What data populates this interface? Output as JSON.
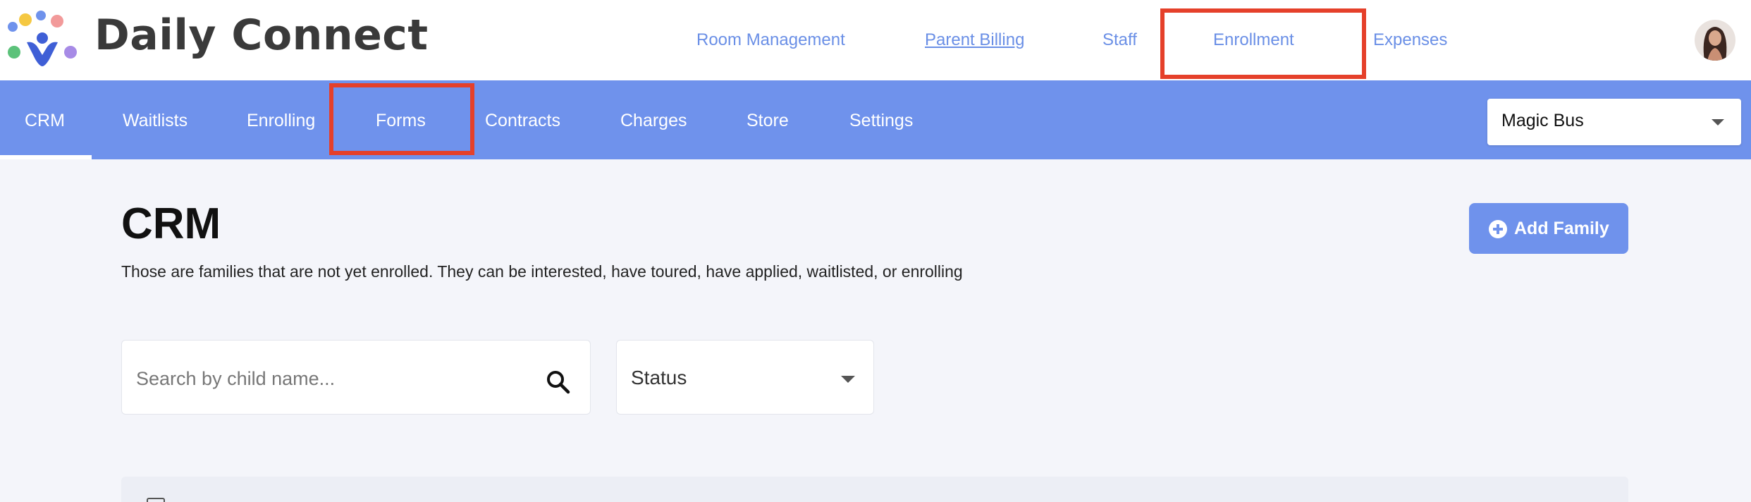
{
  "app": {
    "brand": "Daily Connect"
  },
  "top_nav": {
    "items": [
      {
        "label": "Room Management"
      },
      {
        "label": "Parent Billing"
      },
      {
        "label": "Staff"
      },
      {
        "label": "Enrollment"
      },
      {
        "label": "Expenses"
      }
    ]
  },
  "sub_nav": {
    "items": [
      {
        "label": "CRM"
      },
      {
        "label": "Waitlists"
      },
      {
        "label": "Enrolling"
      },
      {
        "label": "Forms"
      },
      {
        "label": "Contracts"
      },
      {
        "label": "Charges"
      },
      {
        "label": "Store"
      },
      {
        "label": "Settings"
      }
    ],
    "active": "CRM",
    "location_select": {
      "value": "Magic Bus"
    }
  },
  "main": {
    "title": "CRM",
    "description": "Those are families that are not yet enrolled. They can be interested, have toured, have applied, waitlisted, or enrolling",
    "add_family_label": "Add Family",
    "search": {
      "placeholder": "Search by child name...",
      "value": ""
    },
    "status_filter": {
      "value": "Status"
    }
  },
  "colors": {
    "accent": "#6f92ec",
    "link": "#6a8fe6",
    "highlight": "#e5402a",
    "background": "#f4f5fa"
  },
  "icons": [
    "logo-people-icon",
    "search-icon",
    "chevron-down-icon",
    "plus-circle-icon",
    "avatar"
  ]
}
